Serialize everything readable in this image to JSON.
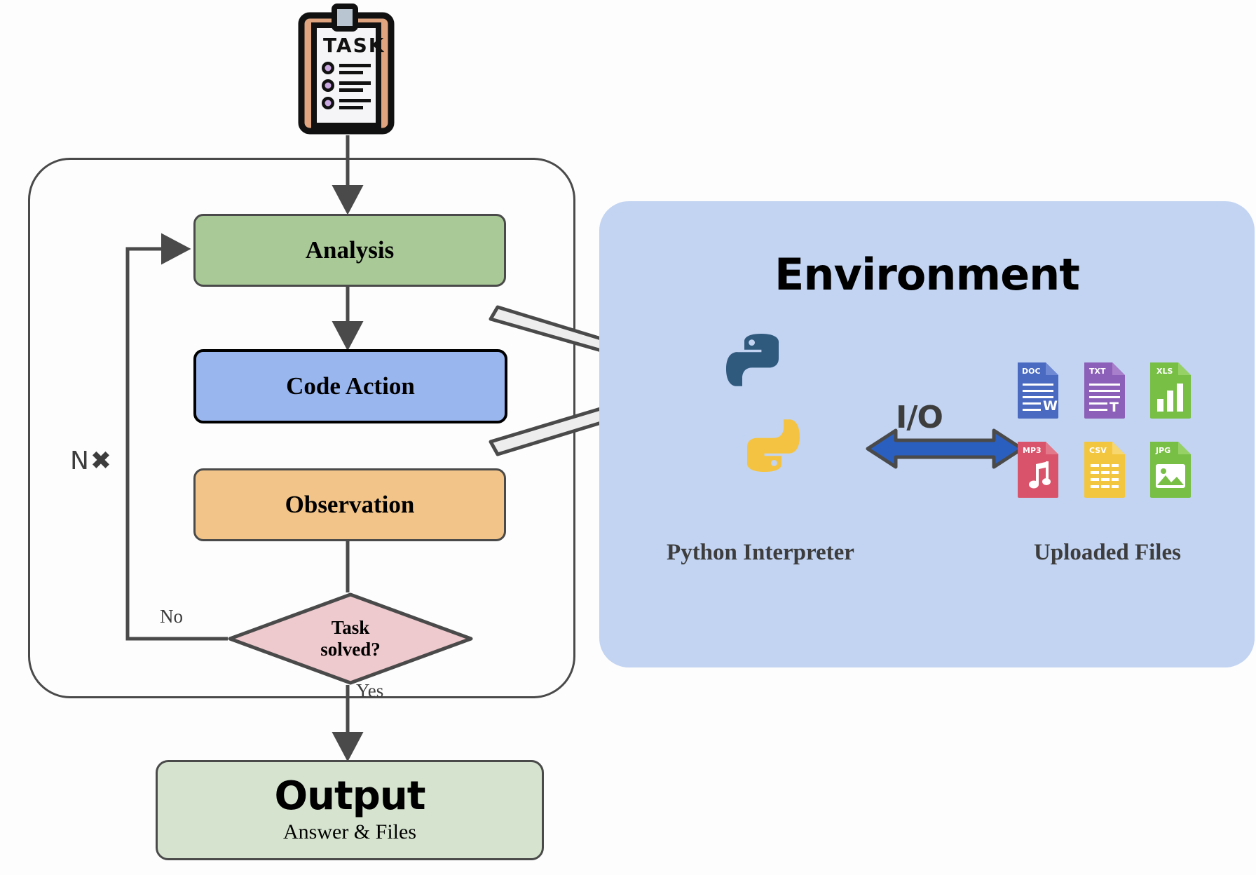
{
  "diagram": {
    "title": "Agent loop with code execution environment",
    "task_icon": {
      "name": "task-clipboard-icon",
      "label": "TASK",
      "checklist_items": 3
    },
    "loop": {
      "repeat_label": "N✖",
      "steps": [
        {
          "id": "analysis",
          "label": "Analysis",
          "color": "#a9c997"
        },
        {
          "id": "code_action",
          "label": "Code Action",
          "color": "#9ab6ee"
        },
        {
          "id": "observation",
          "label": "Observation",
          "color": "#f2c489"
        }
      ],
      "decision": {
        "line1": "Task",
        "line2": "solved?",
        "color": "#eec9cd",
        "branch_no": "No",
        "branch_yes": "Yes"
      }
    },
    "output": {
      "title": "Output",
      "subtitle": "Answer & Files",
      "color": "#d6e4cf"
    },
    "environment": {
      "title": "Environment",
      "panel_color": "#c2d4f2",
      "interpreter_label": "Python  Interpreter",
      "files_label": "Uploaded Files",
      "io_label": "I/O",
      "io_arrow_color": "#2a5fc0",
      "python_logo": {
        "top_color": "#30597e",
        "bottom_color": "#f5c342"
      },
      "files": [
        {
          "ext": "DOC",
          "glyph": "W",
          "color": "#4a69c0",
          "fold": "#6f89d4"
        },
        {
          "ext": "TXT",
          "glyph": "T",
          "color": "#8c5fb8",
          "fold": "#a87fcb"
        },
        {
          "ext": "XLS",
          "glyph": "chart",
          "color": "#77bf45",
          "fold": "#96d166"
        },
        {
          "ext": "MP3",
          "glyph": "note",
          "color": "#d9546b",
          "fold": "#e3788a"
        },
        {
          "ext": "CSV",
          "glyph": "table",
          "color": "#f3c63f",
          "fold": "#f7d76f"
        },
        {
          "ext": "JPG",
          "glyph": "image",
          "color": "#77bf45",
          "fold": "#96d166"
        }
      ]
    },
    "connector_colors": {
      "flow_arrow": "#4a4a4a",
      "env_arrow_fill": "#ededed",
      "env_arrow_stroke": "#4a4a4a"
    }
  }
}
